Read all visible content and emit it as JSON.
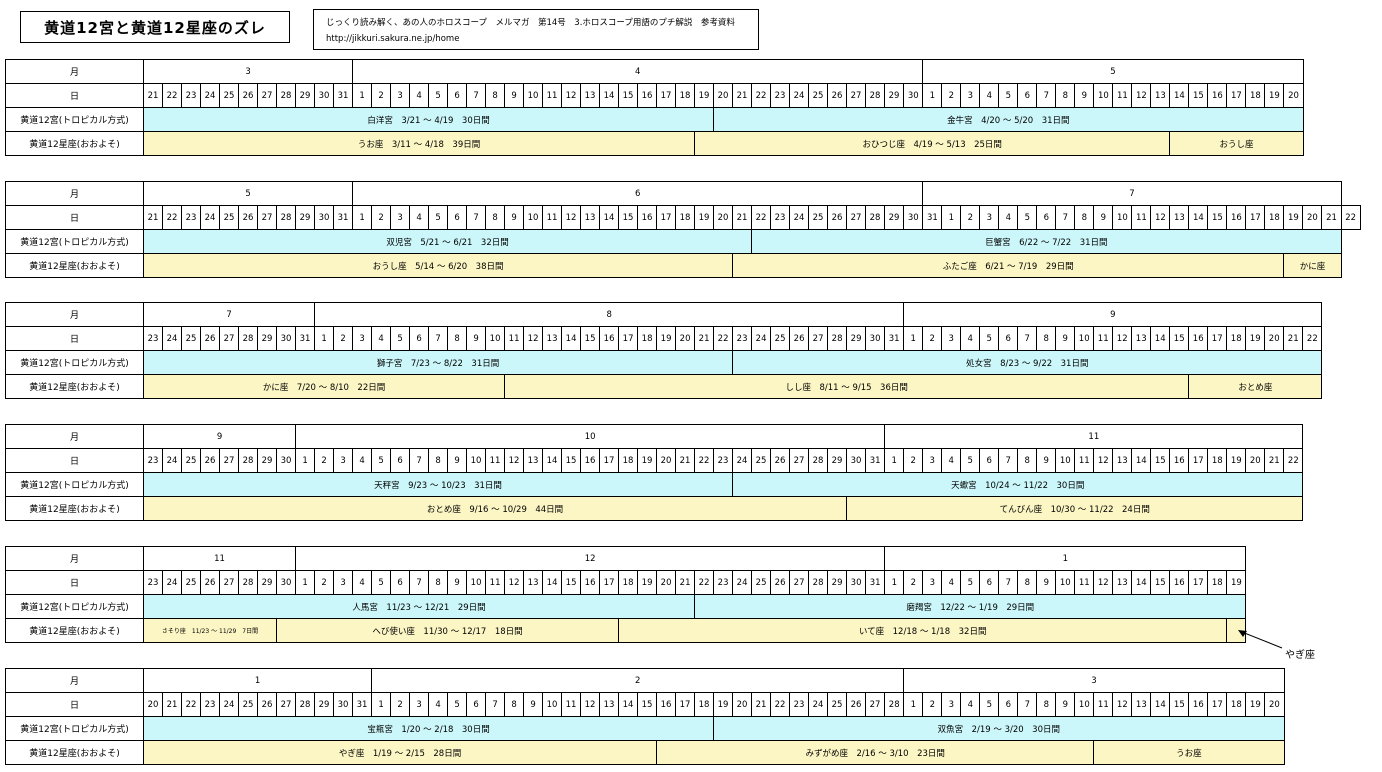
{
  "header": {
    "title": "黄道12宮と黄道12星座のズレ",
    "info_line1": "じっくり読み解く、あの人のホロスコープ　メルマガ　第14号　3.ホロスコープ用語のプチ解説　参考資料",
    "info_line2": "http://jikkuri.sakura.ne.jp/home"
  },
  "labels": {
    "month": "月",
    "day": "日",
    "tropical": "黄道12宮(トロピカル方式)",
    "sidereal": "黄道12星座(おおよそ)"
  },
  "blocks": [
    {
      "months": [
        {
          "label": "3",
          "span": 11
        },
        {
          "label": "4",
          "span": 30
        },
        {
          "label": "5",
          "span": 20
        }
      ],
      "days": [
        "21",
        "22",
        "23",
        "24",
        "25",
        "26",
        "27",
        "28",
        "29",
        "30",
        "31",
        "1",
        "2",
        "3",
        "4",
        "5",
        "6",
        "7",
        "8",
        "9",
        "10",
        "11",
        "12",
        "13",
        "14",
        "15",
        "16",
        "17",
        "18",
        "19",
        "20",
        "21",
        "22",
        "23",
        "24",
        "25",
        "26",
        "27",
        "28",
        "29",
        "30",
        "1",
        "2",
        "3",
        "4",
        "5",
        "6",
        "7",
        "8",
        "9",
        "10",
        "11",
        "12",
        "13",
        "14",
        "15",
        "16",
        "17",
        "18",
        "19",
        "20"
      ],
      "tropical": [
        {
          "label": "白洋宮　3/21 ～ 4/19　30日間",
          "span": 30
        },
        {
          "label": "金牛宮　4/20 ～ 5/20　31日間",
          "span": 31
        }
      ],
      "sidereal": [
        {
          "label": "うお座　3/11 ～ 4/18　39日間",
          "span": 29
        },
        {
          "label": "おひつじ座　4/19 ～ 5/13　25日間",
          "span": 25
        },
        {
          "label": "おうし座",
          "span": 7
        }
      ]
    },
    {
      "months": [
        {
          "label": "5",
          "span": 11
        },
        {
          "label": "6",
          "span": 30
        },
        {
          "label": "7",
          "span": 22
        }
      ],
      "days": [
        "21",
        "22",
        "23",
        "24",
        "25",
        "26",
        "27",
        "28",
        "29",
        "30",
        "31",
        "1",
        "2",
        "3",
        "4",
        "5",
        "6",
        "7",
        "8",
        "9",
        "10",
        "11",
        "12",
        "13",
        "14",
        "15",
        "16",
        "17",
        "18",
        "19",
        "20",
        "21",
        "22",
        "23",
        "24",
        "25",
        "26",
        "27",
        "28",
        "29",
        "30",
        "31",
        "1",
        "2",
        "3",
        "4",
        "5",
        "6",
        "7",
        "8",
        "9",
        "10",
        "11",
        "12",
        "13",
        "14",
        "15",
        "16",
        "17",
        "18",
        "19",
        "20",
        "21",
        "22"
      ],
      "tropical": [
        {
          "label": "双児宮　5/21 ～ 6/21　32日間",
          "span": 32
        },
        {
          "label": "巨蟹宮　6/22 ～ 7/22　31日間",
          "span": 31
        }
      ],
      "sidereal": [
        {
          "label": "おうし座　5/14 ～ 6/20　38日間",
          "span": 31
        },
        {
          "label": "ふたご座　6/21 ～ 7/19　29日間",
          "span": 29
        },
        {
          "label": "かに座",
          "span": 3
        }
      ]
    },
    {
      "months": [
        {
          "label": "7",
          "span": 9
        },
        {
          "label": "8",
          "span": 31
        },
        {
          "label": "9",
          "span": 22
        }
      ],
      "days": [
        "23",
        "24",
        "25",
        "26",
        "27",
        "28",
        "29",
        "30",
        "31",
        "1",
        "2",
        "3",
        "4",
        "5",
        "6",
        "7",
        "8",
        "9",
        "10",
        "11",
        "12",
        "13",
        "14",
        "15",
        "16",
        "17",
        "18",
        "19",
        "20",
        "21",
        "22",
        "23",
        "24",
        "25",
        "26",
        "27",
        "28",
        "29",
        "30",
        "31",
        "1",
        "2",
        "3",
        "4",
        "5",
        "6",
        "7",
        "8",
        "9",
        "10",
        "11",
        "12",
        "13",
        "14",
        "15",
        "16",
        "17",
        "18",
        "19",
        "20",
        "21",
        "22"
      ],
      "tropical": [
        {
          "label": "獅子宮　7/23 ～ 8/22　31日間",
          "span": 31
        },
        {
          "label": "処女宮　8/23 ～ 9/22　31日間",
          "span": 31
        }
      ],
      "sidereal": [
        {
          "label": "かに座　7/20 ～ 8/10　22日間",
          "span": 19
        },
        {
          "label": "しし座　8/11 ～ 9/15　36日間",
          "span": 36
        },
        {
          "label": "おとめ座",
          "span": 7
        }
      ]
    },
    {
      "months": [
        {
          "label": "9",
          "span": 8
        },
        {
          "label": "10",
          "span": 31
        },
        {
          "label": "11",
          "span": 22
        }
      ],
      "days": [
        "23",
        "24",
        "25",
        "26",
        "27",
        "28",
        "29",
        "30",
        "1",
        "2",
        "3",
        "4",
        "5",
        "6",
        "7",
        "8",
        "9",
        "10",
        "11",
        "12",
        "13",
        "14",
        "15",
        "16",
        "17",
        "18",
        "19",
        "20",
        "21",
        "22",
        "23",
        "24",
        "25",
        "26",
        "27",
        "28",
        "29",
        "30",
        "31",
        "1",
        "2",
        "3",
        "4",
        "5",
        "6",
        "7",
        "8",
        "9",
        "10",
        "11",
        "12",
        "13",
        "14",
        "15",
        "16",
        "17",
        "18",
        "19",
        "20",
        "21",
        "22"
      ],
      "tropical": [
        {
          "label": "天秤宮　9/23 ～ 10/23　31日間",
          "span": 31
        },
        {
          "label": "天蠍宮　10/24 ～ 11/22　30日間",
          "span": 30
        }
      ],
      "sidereal": [
        {
          "label": "おとめ座　9/16 ～ 10/29　44日間",
          "span": 37
        },
        {
          "label": "てんびん座　10/30 ～ 11/22　24日間",
          "span": 24
        }
      ]
    },
    {
      "months": [
        {
          "label": "11",
          "span": 8
        },
        {
          "label": "12",
          "span": 31
        },
        {
          "label": "1",
          "span": 19
        }
      ],
      "days": [
        "23",
        "24",
        "25",
        "26",
        "27",
        "28",
        "29",
        "30",
        "1",
        "2",
        "3",
        "4",
        "5",
        "6",
        "7",
        "8",
        "9",
        "10",
        "11",
        "12",
        "13",
        "14",
        "15",
        "16",
        "17",
        "18",
        "19",
        "20",
        "21",
        "22",
        "23",
        "24",
        "25",
        "26",
        "27",
        "28",
        "29",
        "30",
        "31",
        "1",
        "2",
        "3",
        "4",
        "5",
        "6",
        "7",
        "8",
        "9",
        "10",
        "11",
        "12",
        "13",
        "14",
        "15",
        "16",
        "17",
        "18",
        "19"
      ],
      "tropical": [
        {
          "label": "人馬宮　11/23 ～ 12/21　29日間",
          "span": 29
        },
        {
          "label": "磨羯宮　12/22 ～ 1/19　29日間",
          "span": 29
        }
      ],
      "sidereal": [
        {
          "label": "さそり座　11/23 ～ 11/29　7日間",
          "span": 7,
          "small": true
        },
        {
          "label": "へび使い座　11/30 ～ 12/17　18日間",
          "span": 18
        },
        {
          "label": "いて座　12/18 ～ 1/18　32日間",
          "span": 32
        },
        {
          "label": "",
          "span": 1
        }
      ]
    },
    {
      "months": [
        {
          "label": "1",
          "span": 12
        },
        {
          "label": "2",
          "span": 28
        },
        {
          "label": "3",
          "span": 20
        }
      ],
      "days": [
        "20",
        "21",
        "22",
        "23",
        "24",
        "25",
        "26",
        "27",
        "28",
        "29",
        "30",
        "31",
        "1",
        "2",
        "3",
        "4",
        "5",
        "6",
        "7",
        "8",
        "9",
        "10",
        "11",
        "12",
        "13",
        "14",
        "15",
        "16",
        "17",
        "18",
        "19",
        "20",
        "21",
        "22",
        "23",
        "24",
        "25",
        "26",
        "27",
        "28",
        "1",
        "2",
        "3",
        "4",
        "5",
        "6",
        "7",
        "8",
        "9",
        "10",
        "11",
        "12",
        "13",
        "14",
        "15",
        "16",
        "17",
        "18",
        "19",
        "20"
      ],
      "tropical": [
        {
          "label": "宝瓶宮　1/20 ～ 2/18　30日間",
          "span": 30
        },
        {
          "label": "双魚宮　2/19 ～ 3/20　30日間",
          "span": 30
        }
      ],
      "sidereal": [
        {
          "label": "やぎ座　1/19 ～ 2/15　28日間",
          "span": 27
        },
        {
          "label": "みずがめ座　2/16 ～ 3/10　23日間",
          "span": 23
        },
        {
          "label": "うお座",
          "span": 10
        }
      ]
    }
  ],
  "annotation": {
    "yagi": "やぎ座"
  }
}
